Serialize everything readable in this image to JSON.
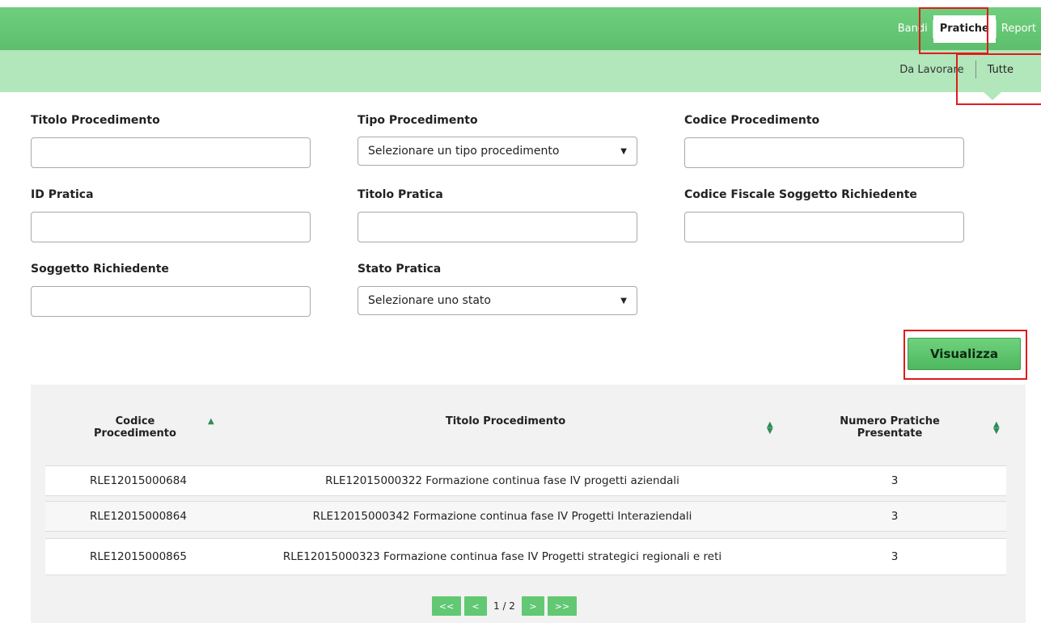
{
  "topnav": {
    "items": [
      "Bandi",
      "Pratiche",
      "Report"
    ],
    "active": "Pratiche"
  },
  "subnav": {
    "items": [
      "Da Lavorare",
      "Tutte"
    ],
    "active": "Tutte"
  },
  "filters": {
    "titolo_procedimento": {
      "label": "Titolo Procedimento",
      "value": ""
    },
    "tipo_procedimento": {
      "label": "Tipo Procedimento",
      "selected": "Selezionare un tipo procedimento"
    },
    "codice_procedimento": {
      "label": "Codice Procedimento",
      "value": ""
    },
    "id_pratica": {
      "label": "ID Pratica",
      "value": ""
    },
    "titolo_pratica": {
      "label": "Titolo Pratica",
      "value": ""
    },
    "codice_fiscale": {
      "label": "Codice Fiscale Soggetto Richiedente",
      "value": ""
    },
    "soggetto_richiedente": {
      "label": "Soggetto Richiedente",
      "value": ""
    },
    "stato_pratica": {
      "label": "Stato Pratica",
      "selected": "Selezionare uno stato"
    }
  },
  "actions": {
    "visualizza": "Visualizza"
  },
  "table": {
    "headers": {
      "codice": "Codice\nProcedimento",
      "titolo": "Titolo Procedimento",
      "numero": "Numero Pratiche\nPresentate"
    },
    "rows": [
      {
        "codice": "RLE12015000684",
        "titolo": "RLE12015000322 Formazione continua fase IV progetti aziendali",
        "numero": "3"
      },
      {
        "codice": "RLE12015000864",
        "titolo": "RLE12015000342 Formazione continua fase IV Progetti Interaziendali",
        "numero": "3"
      },
      {
        "codice": "RLE12015000865",
        "titolo": "RLE12015000323 Formazione continua fase IV Progetti strategici regionali e reti",
        "numero": "3"
      }
    ]
  },
  "pagination": {
    "first": "<<",
    "prev": "<",
    "info": "1 / 2",
    "next": ">",
    "last": ">>"
  },
  "colors": {
    "accent": "#5dbf6c",
    "subbar": "#b2e6bb",
    "highlight": "#e01b1b"
  }
}
